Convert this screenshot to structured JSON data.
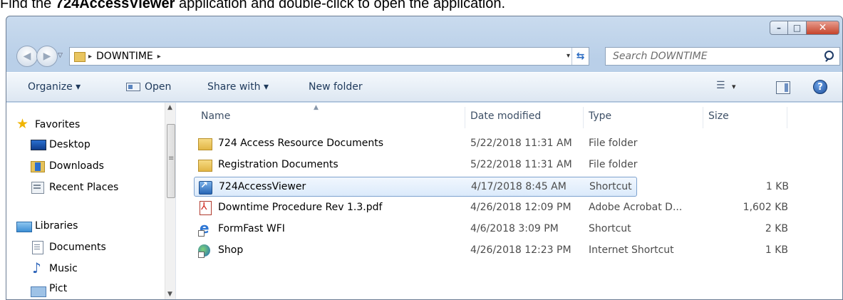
{
  "instruction": {
    "prefix": "Find the ",
    "bold": "724AccessViewer",
    "suffix": " application and double-click to open the application."
  },
  "window": {
    "controls": {
      "minimize": "–",
      "maximize": "□",
      "close": "✕"
    }
  },
  "address": {
    "crumb": "DOWNTIME",
    "separator": "▸",
    "trailing_separator": "▸",
    "dropdown": "▾",
    "refresh": "⇆"
  },
  "search": {
    "placeholder": "Search DOWNTIME"
  },
  "toolbar": {
    "organize": "Organize ▾",
    "open": "Open",
    "share_with": "Share with ▾",
    "new_folder": "New folder",
    "views_arrow": "▾",
    "help": "?"
  },
  "navigation": {
    "favorites": "Favorites",
    "desktop": "Desktop",
    "downloads": "Downloads",
    "recent_places": "Recent Places",
    "libraries": "Libraries",
    "documents": "Documents",
    "music": "Music",
    "pictures": "Pict"
  },
  "columns": {
    "name": "Name",
    "date": "Date modified",
    "type": "Type",
    "size": "Size"
  },
  "files": [
    {
      "name": "724 Access Resource Documents",
      "date": "5/22/2018 11:31 AM",
      "type": "File folder",
      "size": "",
      "icon": "folder-icon"
    },
    {
      "name": "Registration Documents",
      "date": "5/22/2018 11:31 AM",
      "type": "File folder",
      "size": "",
      "icon": "folder-icon"
    },
    {
      "name": "724AccessViewer",
      "date": "4/17/2018 8:45 AM",
      "type": "Shortcut",
      "size": "1 KB",
      "icon": "shortcut-icon"
    },
    {
      "name": "Downtime Procedure Rev 1.3.pdf",
      "date": "4/26/2018 12:09 PM",
      "type": "Adobe Acrobat D...",
      "size": "1,602 KB",
      "icon": "pdf-icon"
    },
    {
      "name": "FormFast WFI",
      "date": "4/6/2018 3:09 PM",
      "type": "Shortcut",
      "size": "2 KB",
      "icon": "ie-icon"
    },
    {
      "name": "Shop",
      "date": "4/26/2018 12:23 PM",
      "type": "Internet Shortcut",
      "size": "1 KB",
      "icon": "shop-icon"
    }
  ],
  "selected_file": "724AccessViewer"
}
